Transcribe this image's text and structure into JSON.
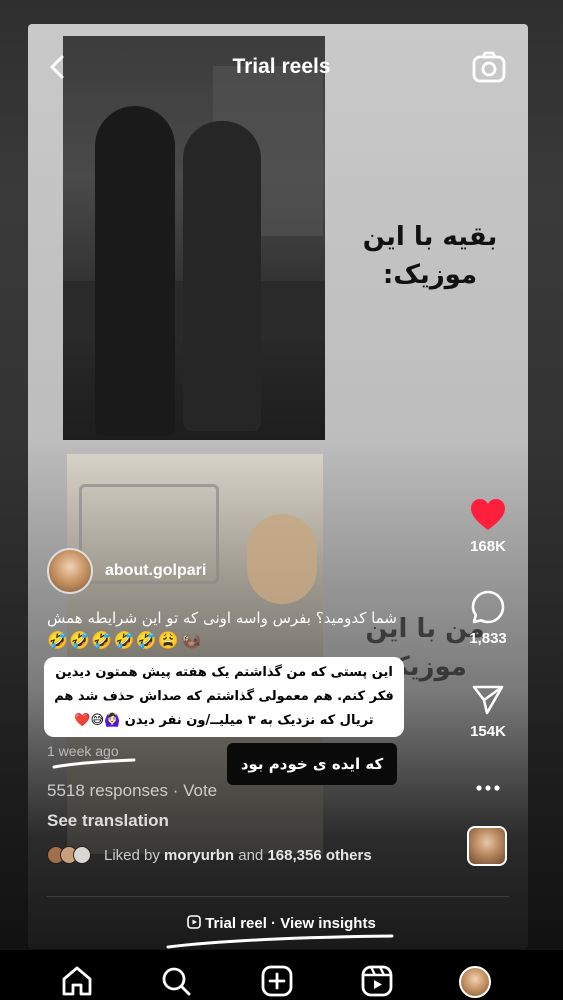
{
  "header": {
    "title": "Trial reels"
  },
  "video": {
    "overlay_text_1": "بقیه با این موزیک:",
    "overlay_text_2": "من با این موزیک"
  },
  "actions": {
    "like_count": "168K",
    "comment_count": "1,833",
    "share_count": "154K",
    "like_color": "#ff1f3d"
  },
  "post": {
    "username": "about.golpari",
    "caption": "شما کدومید؟ بفرس واسه اونی که تو این شرایطه همش",
    "caption_emojis": "🤣🤣🤣🤣🤣😩🦦",
    "sticker_text": "این پستی که من گذاشتم یک هفته پیش همتون دیدین فکر کنم. هم معمولی گذاشتم که صداش حذف شد هم تریال که نزدیک به ۳ میلیــ/ون نفر دیدن 🙆🏻‍♀️😅❤️",
    "bubble_text": "که ایده ی خودم بود",
    "time": "1 week ago",
    "responses": "5518 responses · Vote",
    "see_translation": "See translation",
    "liked_by_prefix": "Liked by",
    "liked_by_user": "moryurbn",
    "liked_by_suffix": "and",
    "liked_by_others": "168,356 others"
  },
  "footer": {
    "trial_label": "Trial reel · View insights"
  },
  "tabs": [
    "home-icon",
    "search-icon",
    "create-icon",
    "reels-icon",
    "profile-avatar"
  ]
}
